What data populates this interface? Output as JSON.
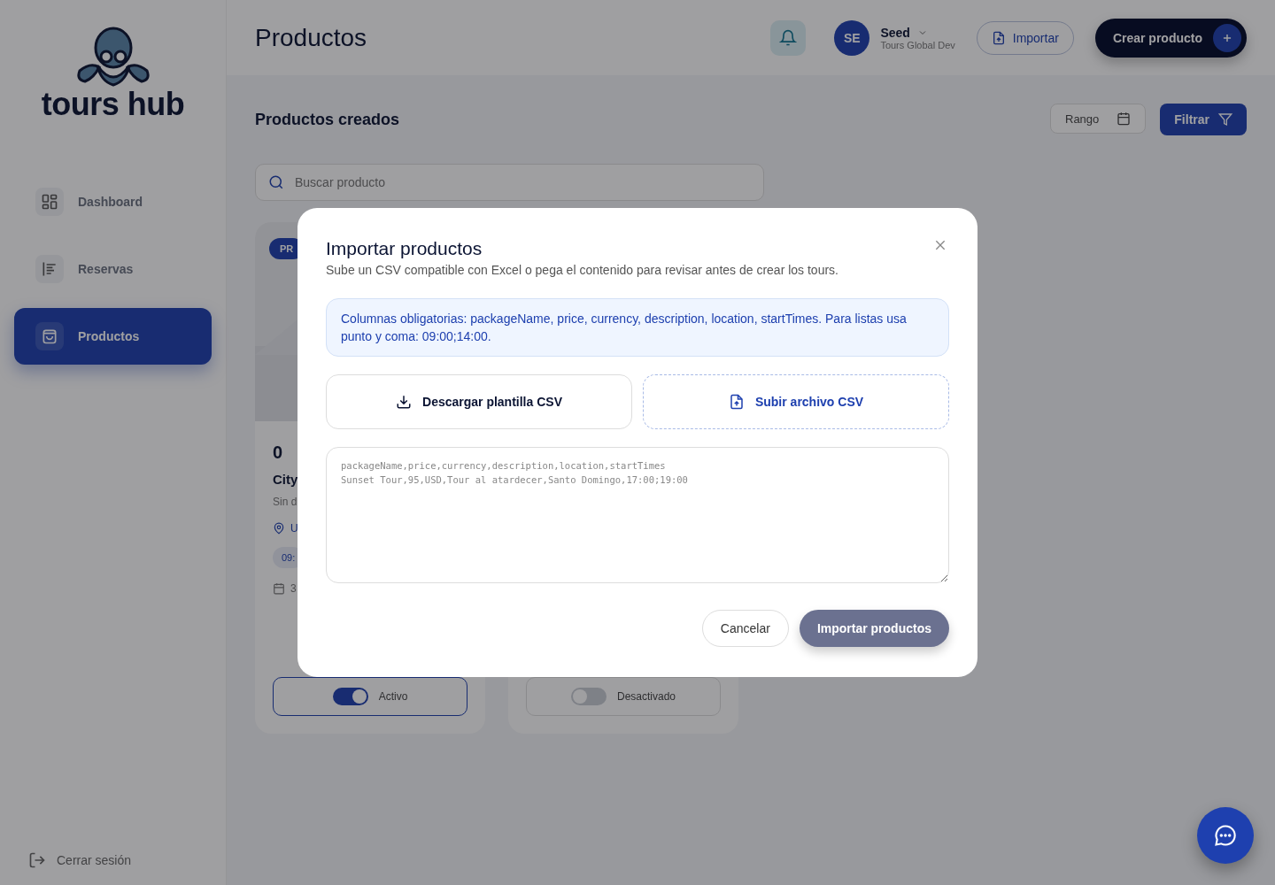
{
  "sidebar": {
    "brand": "tours hub",
    "items": [
      {
        "label": "Dashboard",
        "kind": "grid",
        "selected": false
      },
      {
        "label": "Reservas",
        "kind": "list",
        "selected": false
      },
      {
        "label": "Productos",
        "kind": "bag",
        "selected": true
      }
    ],
    "logout": "Cerrar sesión"
  },
  "header": {
    "title": "Productos",
    "user": {
      "initials": "SE",
      "name": "Seed",
      "org": "Tours Global Dev"
    },
    "import_label": "Importar",
    "create_label": "Crear producto"
  },
  "toolbar": {
    "section_title": "Productos creados",
    "range_label": "Rango",
    "filter_label": "Filtrar",
    "search": {
      "placeholder": "Buscar producto"
    }
  },
  "cards": [
    {
      "badge": "PR",
      "price": "0",
      "name": "City",
      "description": "Sin d",
      "location": "U",
      "time_chip": "09:",
      "date": "3",
      "status": {
        "on": true,
        "label": "Activo"
      }
    },
    {
      "status": {
        "on": false,
        "label": "Desactivado"
      }
    }
  ],
  "modal": {
    "title": "Importar productos",
    "subtitle": "Sube un CSV compatible con Excel o pega el contenido para revisar antes de crear los tours.",
    "notice": "Columnas obligatorias: packageName, price, currency, description, location, startTimes. Para listas usa punto y coma: 09:00;14:00.",
    "download_label": "Descargar plantilla CSV",
    "upload_label": "Subir archivo CSV",
    "csv": {
      "placeholder": "packageName,price,currency,description,location,startTimes\nSunset Tour,95,USD,Tour al atardecer,Santo Domingo,17:00;19:00"
    },
    "cancel_label": "Cancelar",
    "submit": {
      "label": "Importar productos",
      "disabled": true
    }
  }
}
